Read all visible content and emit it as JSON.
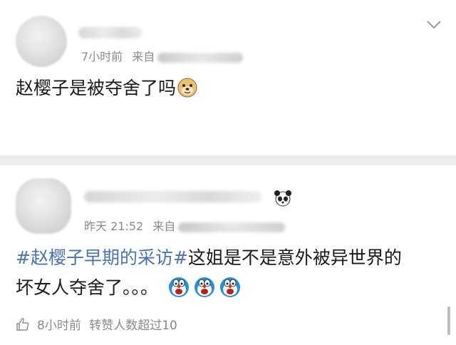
{
  "post1": {
    "time": "7小时前",
    "source_prefix": "来自",
    "text": "赵樱子是被夺舍了吗",
    "emoji_icon": "doge-emoji-icon"
  },
  "post2": {
    "time": "昨天 21:52",
    "source_prefix": "来自",
    "topic": "#赵樱子早期的采访#",
    "text_line1": "这姐是不是意外被异世界的",
    "text_line2": "坏女人夺舍了。。。",
    "emoji_icons": [
      "doraemon-shocked-icon",
      "doraemon-shocked-icon",
      "doraemon-shocked-icon"
    ],
    "footer_time": "8小时前",
    "footer_text": "转赞人数超过10"
  },
  "colors": {
    "topic": "#4d74a8",
    "meta": "#8a8a8a",
    "divider": "#ececec"
  }
}
